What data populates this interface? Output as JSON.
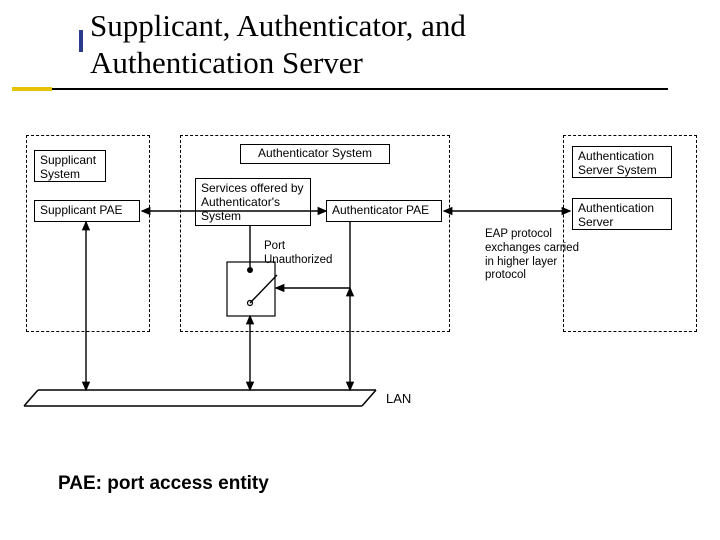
{
  "title": "Supplicant, Authenticator, and\nAuthentication Server",
  "caption": "PAE: port  access  entity",
  "labels": {
    "supplicant_group": "Supplicant\nSystem",
    "supplicant_pae": "Supplicant PAE",
    "authenticator_group": "Authenticator System",
    "services_box": "Services offered\nby Authenticator's\nSystem",
    "authenticator_pae": "Authenticator PAE",
    "port_state": "Port\nUnauthorized",
    "auth_server_group": "Authentication\nServer System",
    "auth_server": "Authentication\nServer",
    "eap_note": "EAP protocol\nexchanges\ncarried in higher\nlayer protocol",
    "lan": "LAN"
  }
}
